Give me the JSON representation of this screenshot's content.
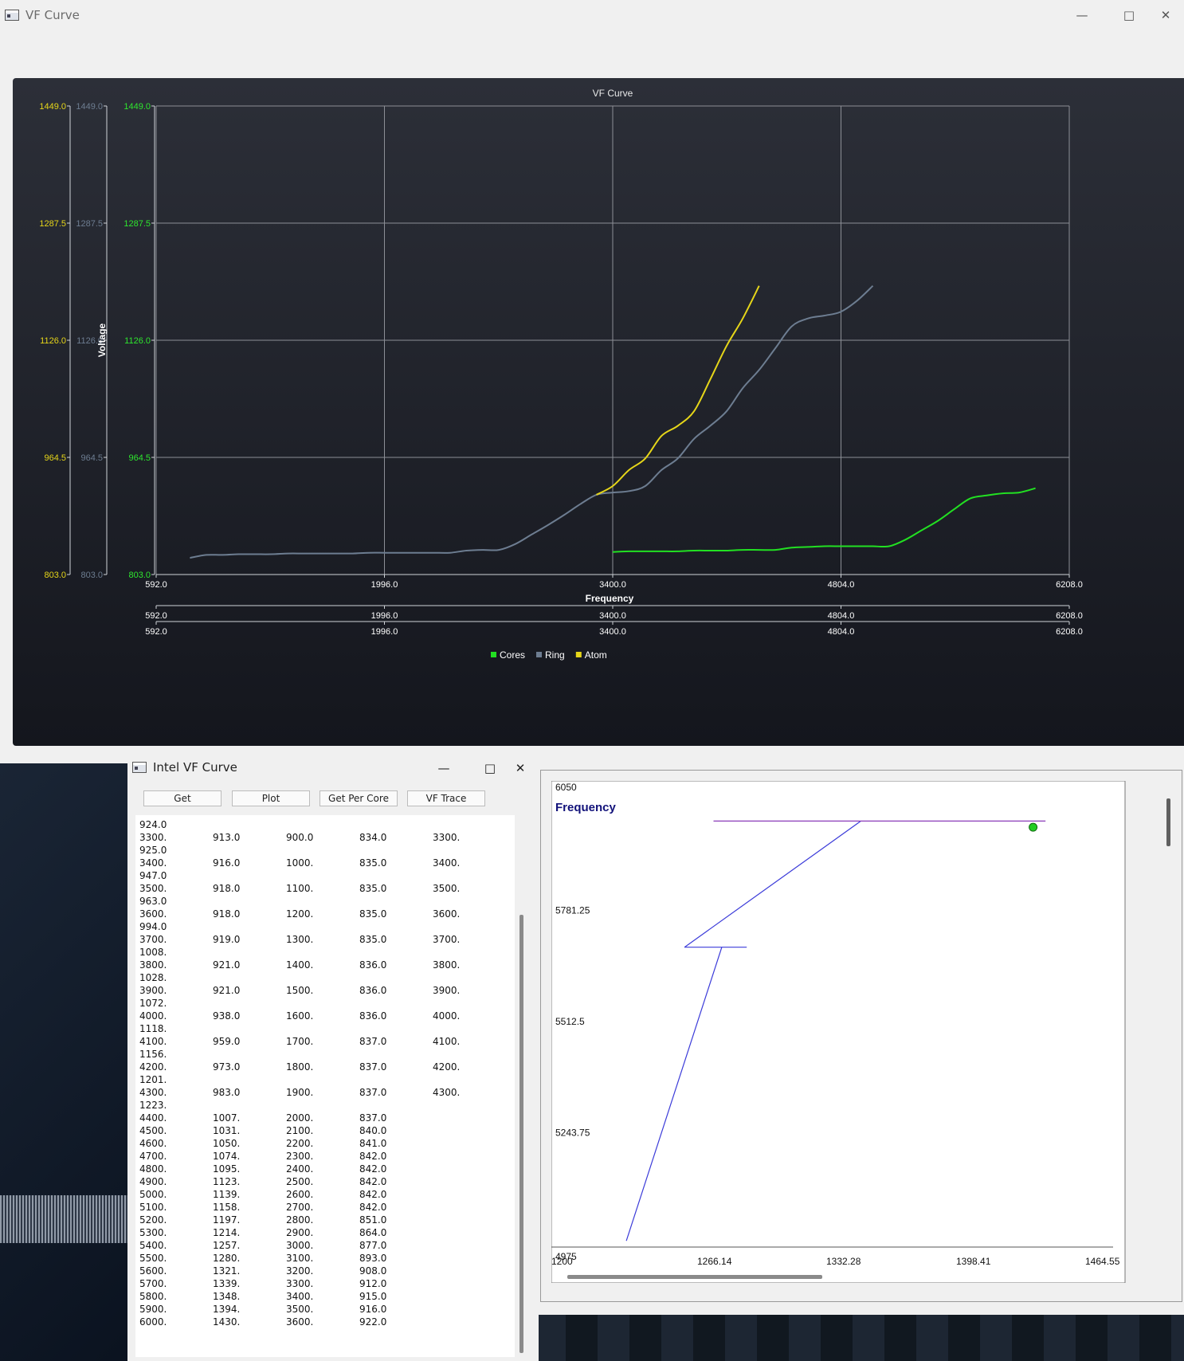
{
  "main_window": {
    "title": "VF Curve",
    "controls": {
      "minimize": "—",
      "maximize": "□",
      "close": "✕"
    }
  },
  "chart_data": [
    {
      "type": "line",
      "title": "VF Curve",
      "xlabel": "Frequency",
      "ylabel": "Voltage",
      "xlim": [
        592.0,
        6208.0
      ],
      "ylim": [
        803.0,
        1449.0
      ],
      "x_ticks": [
        "592.0",
        "1996.0",
        "3400.0",
        "4804.0",
        "6208.0"
      ],
      "y_ticks": [
        "803.0",
        "964.5",
        "1126.0",
        "1287.5",
        "1449.0"
      ],
      "y_axes_colors": [
        "#e6d619",
        "#6d7d91",
        "#2ee62e"
      ],
      "grid": true,
      "legend_position": "bottom",
      "series": [
        {
          "name": "Cores",
          "color": "#22e022",
          "x": [
            3400,
            3500,
            3600,
            3700,
            3800,
            3900,
            4000,
            4100,
            4200,
            4300,
            4400,
            4500,
            4600,
            4700,
            4800,
            4900,
            5000,
            5100,
            5200,
            5300,
            5400,
            5500,
            5600,
            5700,
            5800,
            5900,
            6000
          ],
          "y": [
            834.0,
            835.0,
            835.0,
            835.0,
            835.0,
            836.0,
            836.0,
            836.0,
            837.0,
            837.0,
            837.0,
            840.0,
            841.0,
            842.0,
            842.0,
            842.0,
            842.0,
            842.0,
            851.0,
            864.0,
            877.0,
            893.0,
            908.0,
            912.0,
            915.0,
            916.0,
            922.0
          ]
        },
        {
          "name": "Ring",
          "color": "#6d7d91",
          "x": [
            800,
            900,
            1000,
            1100,
            1200,
            1300,
            1400,
            1500,
            1600,
            1700,
            1800,
            1900,
            2000,
            2100,
            2200,
            2300,
            2400,
            2500,
            2600,
            2700,
            2800,
            2900,
            3000,
            3100,
            3200,
            3300,
            3400,
            3500,
            3600,
            3700,
            3800,
            3900,
            4000,
            4100,
            4200,
            4300,
            4400,
            4500,
            4600,
            4700,
            4800,
            4900,
            5000
          ],
          "y": [
            826.0,
            830.0,
            830.0,
            831.0,
            831.0,
            831.0,
            832.0,
            832.0,
            832.0,
            832.0,
            832.0,
            833.0,
            833.0,
            833.0,
            833.0,
            833.0,
            833.0,
            836.0,
            837.0,
            837.0,
            845.0,
            858.0,
            871.0,
            885.0,
            900.0,
            913.0,
            916.0,
            918.0,
            925.0,
            947.0,
            963.0,
            990.0,
            1008.0,
            1028.0,
            1060.0,
            1085.0,
            1115.0,
            1145.0,
            1156.0,
            1160.0,
            1165.0,
            1180.0,
            1201.0
          ]
        },
        {
          "name": "Atom",
          "color": "#e6d619",
          "x": [
            3300,
            3400,
            3500,
            3600,
            3700,
            3800,
            3900,
            4000,
            4100,
            4200,
            4300
          ],
          "y": [
            913.0,
            925.0,
            947.0,
            963.0,
            994.0,
            1008.0,
            1028.0,
            1072.0,
            1118.0,
            1156.0,
            1201.0
          ]
        }
      ]
    },
    {
      "type": "line",
      "title": "Frequency",
      "xlim": [
        1200,
        1464.55
      ],
      "ylim": [
        4975,
        6050
      ],
      "x_ticks": [
        "1200",
        "1266.14",
        "1332.28",
        "1398.41",
        "1464.55"
      ],
      "y_ticks": [
        "4975",
        "5243.75",
        "5512.5",
        "5781.25",
        "6050"
      ],
      "series": [
        {
          "color": "#3b3bd9",
          "x": [
            1230,
            1276,
            1258,
            1288
          ],
          "y": [
            4990,
            5700,
            5700,
            5700
          ]
        },
        {
          "color": "#3b3bd9",
          "x": [
            1258,
            1343
          ],
          "y": [
            5700,
            6005
          ]
        },
        {
          "color": "#8a3bb8",
          "x": [
            1272,
            1432
          ],
          "y": [
            6005,
            6005
          ]
        }
      ],
      "current_point": {
        "x": 1426,
        "y": 5990,
        "color": "#22cc22"
      }
    }
  ],
  "intel_window": {
    "title": "Intel VF Curve",
    "controls": {
      "minimize": "—",
      "maximize": "□",
      "close": "✕"
    },
    "buttons": {
      "get": "Get",
      "plot": "Plot",
      "per_core": "Get Per Core",
      "vf_trace": "VF Trace"
    },
    "rows": [
      [
        "924.0",
        "",
        "",
        "",
        ""
      ],
      [
        "3300.",
        "913.0",
        "900.0",
        "834.0",
        "3300."
      ],
      [
        "925.0",
        "",
        "",
        "",
        ""
      ],
      [
        "3400.",
        "916.0",
        "1000.",
        "835.0",
        "3400."
      ],
      [
        "947.0",
        "",
        "",
        "",
        ""
      ],
      [
        "3500.",
        "918.0",
        "1100.",
        "835.0",
        "3500."
      ],
      [
        "963.0",
        "",
        "",
        "",
        ""
      ],
      [
        "3600.",
        "918.0",
        "1200.",
        "835.0",
        "3600."
      ],
      [
        "994.0",
        "",
        "",
        "",
        ""
      ],
      [
        "3700.",
        "919.0",
        "1300.",
        "835.0",
        "3700."
      ],
      [
        "1008.",
        "",
        "",
        "",
        ""
      ],
      [
        "3800.",
        "921.0",
        "1400.",
        "836.0",
        "3800."
      ],
      [
        "1028.",
        "",
        "",
        "",
        ""
      ],
      [
        "3900.",
        "921.0",
        "1500.",
        "836.0",
        "3900."
      ],
      [
        "1072.",
        "",
        "",
        "",
        ""
      ],
      [
        "4000.",
        "938.0",
        "1600.",
        "836.0",
        "4000."
      ],
      [
        "1118.",
        "",
        "",
        "",
        ""
      ],
      [
        "4100.",
        "959.0",
        "1700.",
        "837.0",
        "4100."
      ],
      [
        "1156.",
        "",
        "",
        "",
        ""
      ],
      [
        "4200.",
        "973.0",
        "1800.",
        "837.0",
        "4200."
      ],
      [
        "1201.",
        "",
        "",
        "",
        ""
      ],
      [
        "4300.",
        "983.0",
        "1900.",
        "837.0",
        "4300."
      ],
      [
        "1223.",
        "",
        "",
        "",
        ""
      ],
      [
        "4400.",
        "1007.",
        "2000.",
        "837.0",
        ""
      ],
      [
        "4500.",
        "1031.",
        "2100.",
        "840.0",
        ""
      ],
      [
        "4600.",
        "1050.",
        "2200.",
        "841.0",
        ""
      ],
      [
        "4700.",
        "1074.",
        "2300.",
        "842.0",
        ""
      ],
      [
        "4800.",
        "1095.",
        "2400.",
        "842.0",
        ""
      ],
      [
        "4900.",
        "1123.",
        "2500.",
        "842.0",
        ""
      ],
      [
        "5000.",
        "1139.",
        "2600.",
        "842.0",
        ""
      ],
      [
        "5100.",
        "1158.",
        "2700.",
        "842.0",
        ""
      ],
      [
        "5200.",
        "1197.",
        "2800.",
        "851.0",
        ""
      ],
      [
        "5300.",
        "1214.",
        "2900.",
        "864.0",
        ""
      ],
      [
        "5400.",
        "1257.",
        "3000.",
        "877.0",
        ""
      ],
      [
        "5500.",
        "1280.",
        "3100.",
        "893.0",
        ""
      ],
      [
        "5600.",
        "1321.",
        "3200.",
        "908.0",
        ""
      ],
      [
        "5700.",
        "1339.",
        "3300.",
        "912.0",
        ""
      ],
      [
        "5800.",
        "1348.",
        "3400.",
        "915.0",
        ""
      ],
      [
        "5900.",
        "1394.",
        "3500.",
        "916.0",
        ""
      ],
      [
        "6000.",
        "1430.",
        "3600.",
        "922.0",
        ""
      ]
    ]
  }
}
